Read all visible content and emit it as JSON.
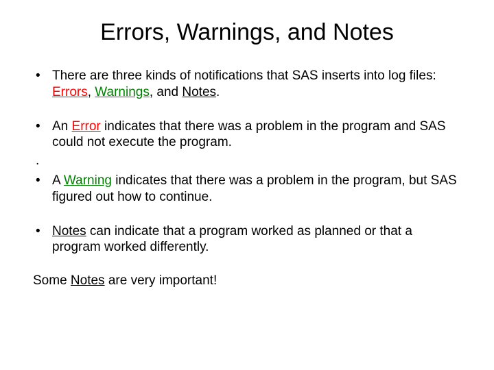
{
  "title": "Errors, Warnings, and Notes",
  "bullet": "•",
  "dot": ".",
  "b1": {
    "t1": "There are three kinds of notifications that SAS inserts into log files: ",
    "err": "Errors",
    "sep1": ", ",
    "warn": "Warnings",
    "sep2": ", and ",
    "notes": "Notes",
    "end": "."
  },
  "b2": {
    "t1": "An ",
    "err": "Error",
    "t2": " indicates that there was a problem in the program and SAS could not execute the program."
  },
  "b3": {
    "t1": "A ",
    "warn": "Warning",
    "t2": " indicates that there was a problem in the program, but SAS figured out how to continue."
  },
  "b4": {
    "notes": "Notes",
    "t1": " can indicate that a program worked as planned or that a program worked differently."
  },
  "closing": {
    "t1": "Some ",
    "notes": "Notes",
    "t2": " are very important!"
  }
}
